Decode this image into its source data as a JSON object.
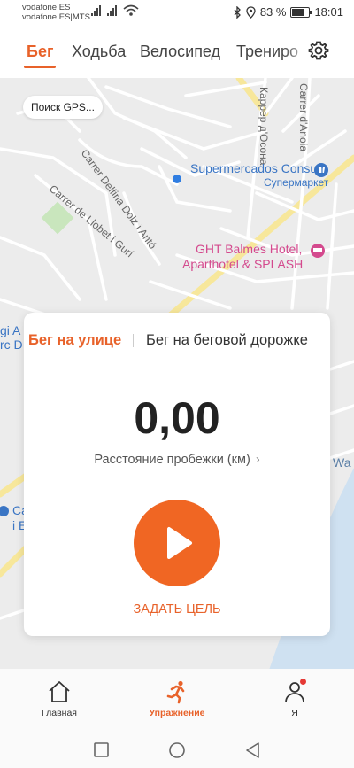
{
  "status_bar": {
    "carrier1": "vodafone ES",
    "carrier2": "vodafone ES|MTS...",
    "battery": "83 %",
    "time": "18:01"
  },
  "tabs": [
    {
      "label": "Бег",
      "active": true
    },
    {
      "label": "Ходьба",
      "active": false
    },
    {
      "label": "Велосипед",
      "active": false
    },
    {
      "label": "Трениро",
      "active": false
    }
  ],
  "map": {
    "gps_status": "Поиск GPS...",
    "streets": [
      "Carrer Delfina Dolz i Antó",
      "Carrer de Llobet i Gurí",
      "Каррер д'Осона",
      "Carrer d'Anoia"
    ],
    "poi1": "Supermercados Consum",
    "poi1_sub": "Супермаркет",
    "poi2_line1": "GHT Balmes Hotel,",
    "poi2_line2": "Aparthotel & SPLASH",
    "edge_left1": "gi A",
    "edge_left2": "rc D",
    "edge_left3": "Ca",
    "edge_left4": "i E",
    "edge_right": "Wa"
  },
  "workout": {
    "mode_outdoor": "Бег на улице",
    "mode_treadmill": "Бег на беговой дорожке",
    "distance_value": "0,00",
    "distance_label": "Расстояние пробежки (км)",
    "goal_label": "ЗАДАТЬ ЦЕЛЬ"
  },
  "bottom_nav": [
    {
      "label": "Главная",
      "icon": "home-icon",
      "active": false
    },
    {
      "label": "Упражнение",
      "icon": "running-figure-icon",
      "active": true
    },
    {
      "label": "Я",
      "icon": "profile-icon",
      "active": false
    }
  ],
  "colors": {
    "accent": "#e8622a",
    "start_button": "#f06623",
    "poi_blue": "#3a75c4",
    "poi_pink": "#d44a8e"
  }
}
